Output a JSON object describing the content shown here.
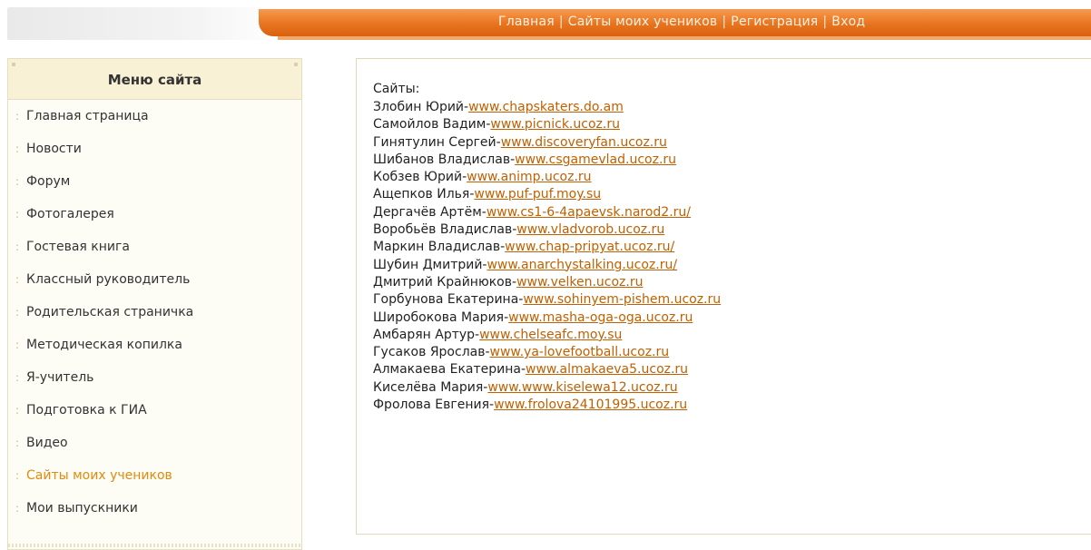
{
  "nav": {
    "items": [
      "Главная",
      "Сайты моих учеников",
      "Регистрация",
      "Вход"
    ],
    "separator": "|"
  },
  "sidebar": {
    "title": "Меню сайта",
    "items": [
      {
        "label": "Главная страница"
      },
      {
        "label": "Новости"
      },
      {
        "label": "Форум"
      },
      {
        "label": "Фотогалерея"
      },
      {
        "label": "Гостевая книга"
      },
      {
        "label": "Классный руководитель"
      },
      {
        "label": "Родительская страничка"
      },
      {
        "label": "Методическая копилка"
      },
      {
        "label": "Я-учитель"
      },
      {
        "label": "Подготовка к ГИА"
      },
      {
        "label": "Видео"
      },
      {
        "label": "Сайты моих учеников"
      },
      {
        "label": "Мои выпускники"
      }
    ],
    "bullet": ":"
  },
  "content": {
    "heading": "Сайты:",
    "sites": [
      {
        "name": "Злобин Юрий-",
        "url": "www.chapskaters.do.am"
      },
      {
        "name": "Самойлов Вадим-",
        "url": "www.picnick.ucoz.ru"
      },
      {
        "name": "Гинятулин Сергей-",
        "url": "www.discoveryfan.ucoz.ru"
      },
      {
        "name": "Шибанов Владислав-",
        "url": "www.csgamevlad.ucoz.ru"
      },
      {
        "name": "Кобзев Юрий-",
        "url": "www.animp.ucoz.ru"
      },
      {
        "name": "Ащепков Илья-",
        "url": "www.puf-puf.moy.su"
      },
      {
        "name": "Дергачёв Артём-",
        "url": "www.cs1-6-4apaevsk.narod2.ru/"
      },
      {
        "name": "Воробьёв Владислав-",
        "url": "www.vladvorob.ucoz.ru"
      },
      {
        "name": "Маркин Владислав-",
        "url": "www.chap-pripyat.ucoz.ru/"
      },
      {
        "name": "Шубин Дмитрий-",
        "url": "www.anarchystalking.ucoz.ru/"
      },
      {
        "name": "Дмитрий Крайнюков-",
        "url": "www.velken.ucoz.ru"
      },
      {
        "name": "Горбунова Екатерина-",
        "url": "www.sohinyem-pishem.ucoz.ru"
      },
      {
        "name": "Широбокова Мария-",
        "url": "www.masha-oga-oga.ucoz.ru"
      },
      {
        "name": "Амбарян Артур-",
        "url": "www.chelseafc.moy.su"
      },
      {
        "name": "Гусаков Ярослав-",
        "url": "www.ya-lovefootball.ucoz.ru"
      },
      {
        "name": "Алмакаева Екатерина-",
        "url": "www.almakaeva5.ucoz.ru"
      },
      {
        "name": "Киселёва Мария-",
        "url": "www.www.kiselewa12.ucoz.ru"
      },
      {
        "name": "Фролова Евгения-",
        "url": "www.frolova24101995.ucoz.ru"
      }
    ]
  },
  "colors": {
    "accent": "#e8741f",
    "link": "#c06000",
    "active_menu": "#e08a10"
  }
}
